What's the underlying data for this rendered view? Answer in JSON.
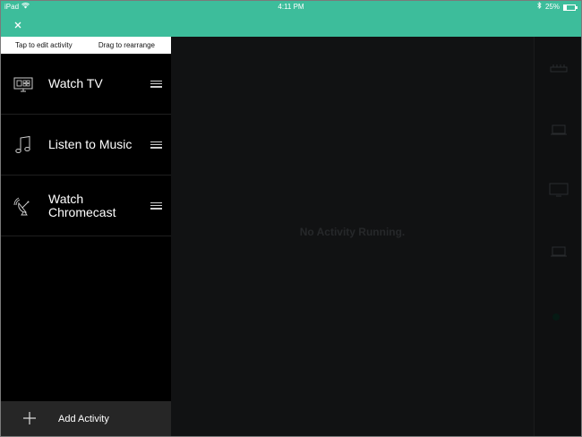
{
  "status_bar": {
    "device": "iPad",
    "time": "4:11 PM",
    "battery": "25%",
    "battery_level": 0.25,
    "icons": [
      "wifi-icon",
      "bluetooth-icon",
      "battery-icon"
    ]
  },
  "toolbar": {
    "close_icon": "close-icon",
    "accent_color": "#3dbd9b"
  },
  "panel": {
    "hint_left": "Tap to edit activity",
    "hint_right": "Drag to rearrange",
    "activities": [
      {
        "label": "Watch TV",
        "icon": "tv-icon"
      },
      {
        "label": "Listen to Music",
        "icon": "music-note-icon"
      },
      {
        "label": "Watch Chromecast",
        "icon": "satellite-dish-icon"
      }
    ],
    "add_label": "Add Activity",
    "add_icon": "plus-icon"
  },
  "main": {
    "empty_message": "No Activity Running."
  },
  "rail": {
    "devices": [
      "receiver-icon",
      "laptop-icon",
      "monitor-icon",
      "laptop-icon"
    ]
  }
}
